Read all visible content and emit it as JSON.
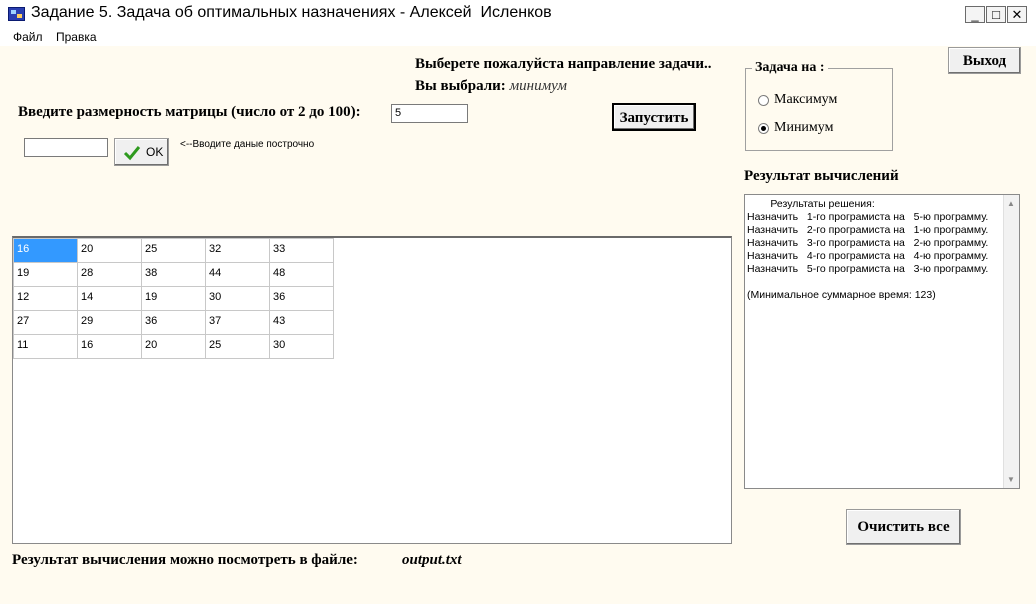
{
  "window": {
    "title": "Задание 5. Задача об оптимальных назначениях - Алексей  Исленков",
    "minimize_glyph": "_",
    "maximize_glyph": "□",
    "close_glyph": "✕"
  },
  "menu": {
    "items": [
      "Файл",
      "Правка"
    ]
  },
  "direction": {
    "prompt": "Выберете пожалуйста направление задачи..",
    "selected_label": "Вы выбрали:",
    "selected_value": "минимум"
  },
  "matrix_size": {
    "label": "Введите размерность матрицы (число от 2 до 100):",
    "value": "5"
  },
  "row_input": {
    "value": "",
    "ok_label": "OK",
    "hint": "<--Вводите даные построчно"
  },
  "buttons": {
    "run": "Запустить",
    "exit": "Выход",
    "clear_all": "Очистить все"
  },
  "task_group": {
    "title": "Задача на :",
    "options": [
      {
        "label": "Максимум",
        "checked": false
      },
      {
        "label": "Минимум",
        "checked": true
      }
    ]
  },
  "result": {
    "heading": "Результат вычислений",
    "text": "        Результаты решения:\nНазначить   1-го програмиста на   5-ю программу.\nНазначить   2-го програмиста на   1-ю программу.\nНазначить   3-го програмиста на   2-ю программу.\nНазначить   4-го програмиста на   4-ю программу.\nНазначить   5-го програмиста на   3-ю программу.\n\n(Минимальное суммарное время: 123)"
  },
  "matrix": {
    "rows": [
      [
        "16",
        "20",
        "25",
        "32",
        "33"
      ],
      [
        "19",
        "28",
        "38",
        "44",
        "48"
      ],
      [
        "12",
        "14",
        "19",
        "30",
        "36"
      ],
      [
        "27",
        "29",
        "36",
        "37",
        "43"
      ],
      [
        "11",
        "16",
        "20",
        "25",
        "30"
      ]
    ],
    "selected_row": 0,
    "selected_col": 0
  },
  "footer": {
    "label": "Результат вычисления можно посмотреть в файле:",
    "file": "output.txt"
  },
  "colors": {
    "background": "#fffbf0",
    "selection": "#3399ff",
    "ok_check": "#2e9a1e"
  }
}
